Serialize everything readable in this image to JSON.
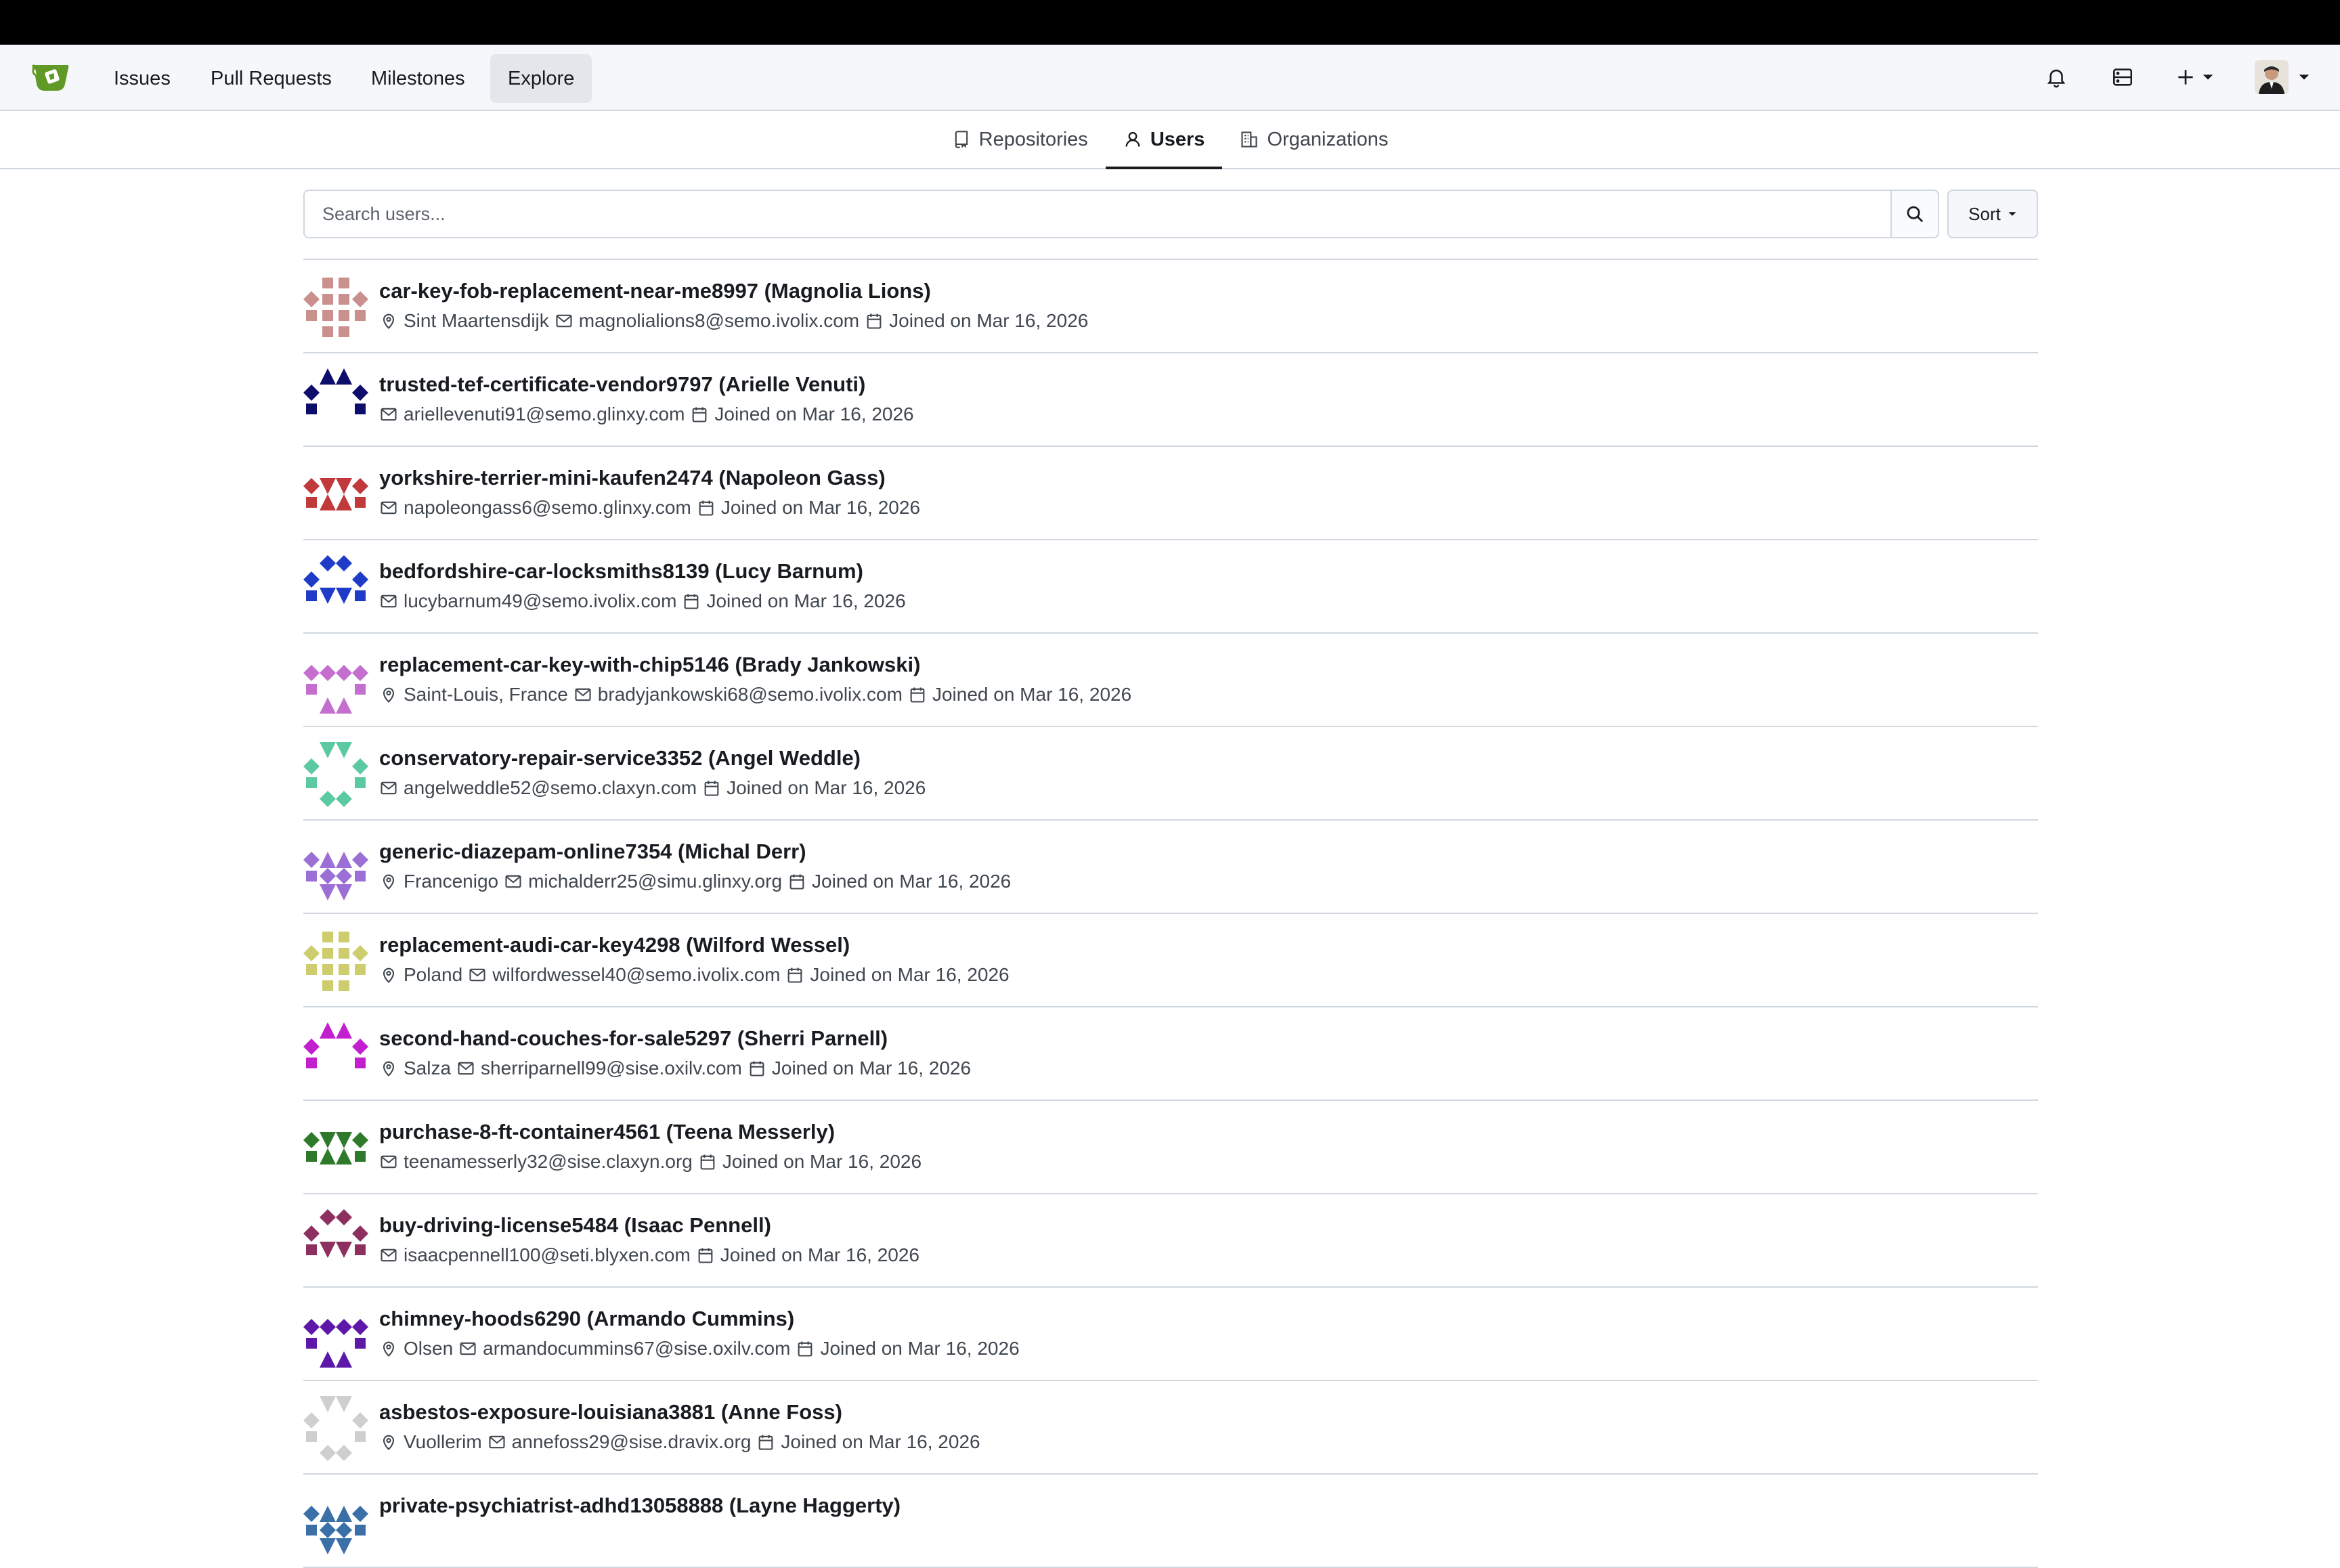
{
  "navbar": {
    "items": [
      {
        "label": "Issues"
      },
      {
        "label": "Pull Requests"
      },
      {
        "label": "Milestones"
      },
      {
        "label": "Explore"
      }
    ]
  },
  "explore_tabs": [
    {
      "label": "Repositories",
      "icon": "repo-icon"
    },
    {
      "label": "Users",
      "icon": "person-icon",
      "active": true
    },
    {
      "label": "Organizations",
      "icon": "organization-icon"
    }
  ],
  "search": {
    "placeholder": "Search users...",
    "value": ""
  },
  "sort_label": "Sort",
  "users": [
    {
      "title": "car-key-fob-replacement-near-me8997 (Magnolia Lions)",
      "location": "Sint Maartensdijk",
      "email": "magnolialions8@semo.ivolix.com",
      "joined": "Joined on Mar 16, 2026",
      "avatar_color": "#c9908e"
    },
    {
      "title": "trusted-tef-certificate-vendor9797 (Arielle Venuti)",
      "location": "",
      "email": "ariellevenuti91@semo.glinxy.com",
      "joined": "Joined on Mar 16, 2026",
      "avatar_color": "#0d0d6b"
    },
    {
      "title": "yorkshire-terrier-mini-kaufen2474 (Napoleon Gass)",
      "location": "",
      "email": "napoleongass6@semo.glinxy.com",
      "joined": "Joined on Mar 16, 2026",
      "avatar_color": "#c0393b"
    },
    {
      "title": "bedfordshire-car-locksmiths8139 (Lucy Barnum)",
      "location": "",
      "email": "lucybarnum49@semo.ivolix.com",
      "joined": "Joined on Mar 16, 2026",
      "avatar_color": "#1f3bc7"
    },
    {
      "title": "replacement-car-key-with-chip5146 (Brady Jankowski)",
      "location": "Saint-Louis, France",
      "email": "bradyjankowski68@semo.ivolix.com",
      "joined": "Joined on Mar 16, 2026",
      "avatar_color": "#c46fd0"
    },
    {
      "title": "conservatory-repair-service3352 (Angel Weddle)",
      "location": "",
      "email": "angelweddle52@semo.claxyn.com",
      "joined": "Joined on Mar 16, 2026",
      "avatar_color": "#5ccaa0"
    },
    {
      "title": "generic-diazepam-online7354 (Michal Derr)",
      "location": "Francenigo",
      "email": "michalderr25@simu.glinxy.org",
      "joined": "Joined on Mar 16, 2026",
      "avatar_color": "#9c6fd6"
    },
    {
      "title": "replacement-audi-car-key4298 (Wilford Wessel)",
      "location": "Poland",
      "email": "wilfordwessel40@semo.ivolix.com",
      "joined": "Joined on Mar 16, 2026",
      "avatar_color": "#cdcd6e"
    },
    {
      "title": "second-hand-couches-for-sale5297 (Sherri Parnell)",
      "location": "Salza",
      "email": "sherriparnell99@sise.oxilv.com",
      "joined": "Joined on Mar 16, 2026",
      "avatar_color": "#c21fcf"
    },
    {
      "title": "purchase-8-ft-container4561 (Teena Messerly)",
      "location": "",
      "email": "teenamesserly32@sise.claxyn.org",
      "joined": "Joined on Mar 16, 2026",
      "avatar_color": "#2f7a2a"
    },
    {
      "title": "buy-driving-license5484 (Isaac Pennell)",
      "location": "",
      "email": "isaacpennell100@seti.blyxen.com",
      "joined": "Joined on Mar 16, 2026",
      "avatar_color": "#8d2f5f"
    },
    {
      "title": "chimney-hoods6290 (Armando Cummins)",
      "location": "Olsen",
      "email": "armandocummins67@sise.oxilv.com",
      "joined": "Joined on Mar 16, 2026",
      "avatar_color": "#5e18a8"
    },
    {
      "title": "asbestos-exposure-louisiana3881 (Anne Foss)",
      "location": "Vuollerim",
      "email": "annefoss29@sise.dravix.org",
      "joined": "Joined on Mar 16, 2026",
      "avatar_color": "#cfcfcf"
    },
    {
      "title": "private-psychiatrist-adhd13058888 (Layne Haggerty)",
      "location": "",
      "email": "",
      "joined": "",
      "avatar_color": "#3b6fa8"
    }
  ]
}
